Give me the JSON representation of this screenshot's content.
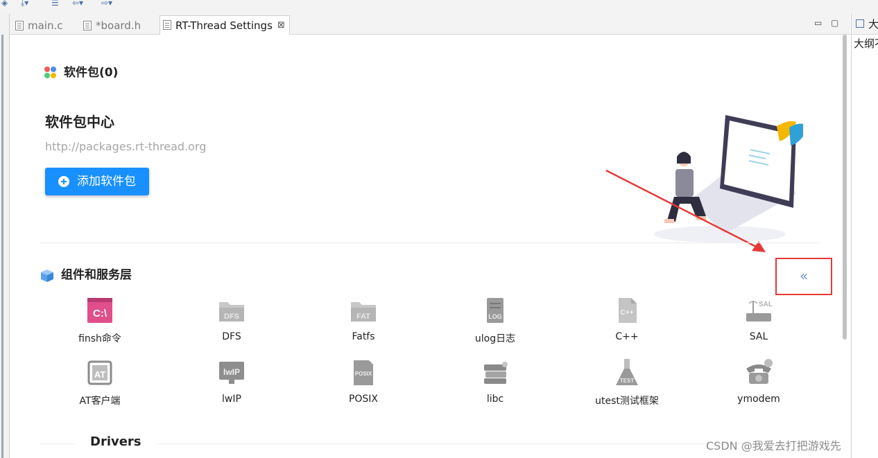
{
  "tabs": [
    {
      "label": "main.c"
    },
    {
      "label": "*board.h"
    },
    {
      "label": "RT-Thread Settings",
      "active": true,
      "close": "⊠"
    }
  ],
  "window_controls": {
    "minimize": "▭",
    "maximize": "▢"
  },
  "outline_panel": {
    "tab_label": "大",
    "text": "大纲不"
  },
  "packages": {
    "header": "软件包(0)",
    "center_title": "软件包中心",
    "center_url": "http://packages.rt-thread.org",
    "add_button": "添加软件包"
  },
  "components": {
    "header": "组件和服务层",
    "collapse_glyph": "«",
    "items": [
      {
        "label": "finsh命令",
        "icon": "terminal-icon"
      },
      {
        "label": "DFS",
        "icon": "folder-icon"
      },
      {
        "label": "Fatfs",
        "icon": "folder-icon"
      },
      {
        "label": "ulog日志",
        "icon": "log-icon"
      },
      {
        "label": "C++",
        "icon": "file-icon"
      },
      {
        "label": "SAL",
        "icon": "router-icon"
      },
      {
        "label": "AT客户端",
        "icon": "at-icon"
      },
      {
        "label": "lwIP",
        "icon": "monitor-icon"
      },
      {
        "label": "POSIX",
        "icon": "document-icon"
      },
      {
        "label": "libc",
        "icon": "books-icon"
      },
      {
        "label": "utest测试框架",
        "icon": "flask-icon"
      },
      {
        "label": "ymodem",
        "icon": "phone-icon"
      }
    ]
  },
  "drivers": {
    "title": "Drivers"
  },
  "watermark": "CSDN @我爱去打把游戏先"
}
